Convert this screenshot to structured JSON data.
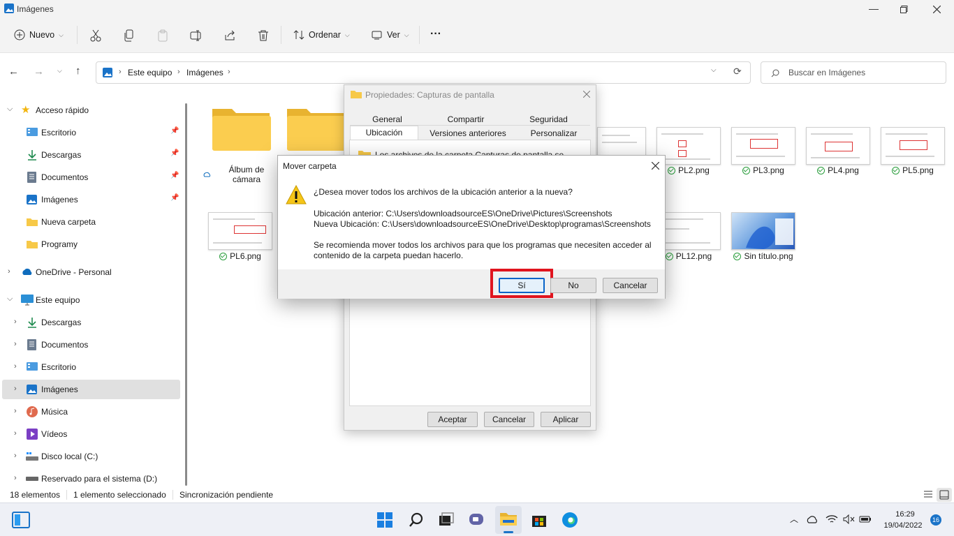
{
  "window": {
    "title": "Imágenes"
  },
  "toolbar": {
    "new_label": "Nuevo",
    "sort_label": "Ordenar",
    "view_label": "Ver",
    "more_label": "···"
  },
  "address": {
    "crumbs": [
      "Este equipo",
      "Imágenes"
    ],
    "search_placeholder": "Buscar en Imágenes"
  },
  "sidebar": {
    "quick_access": "Acceso rápido",
    "quick_items": [
      "Escritorio",
      "Descargas",
      "Documentos",
      "Imágenes",
      "Nueva carpeta",
      "Programy"
    ],
    "onedrive": "OneDrive - Personal",
    "this_pc": "Este equipo",
    "pc_items": [
      "Descargas",
      "Documentos",
      "Escritorio",
      "Imágenes",
      "Música",
      "Vídeos",
      "Disco local (C:)",
      "Reservado para el sistema (D:)"
    ]
  },
  "files": {
    "camera_folder": "Álbum de cámara",
    "row1": [
      "PL2.png",
      "PL3.png",
      "PL4.png",
      "PL5.png"
    ],
    "row2_first": "PL6.png",
    "row2_last": [
      "PL12.png",
      "Sin título.png"
    ]
  },
  "properties": {
    "title": "Propiedades: Capturas de pantalla",
    "tabs_top": [
      "General",
      "Compartir",
      "Seguridad"
    ],
    "tabs_bottom": [
      "Ubicación",
      "Versiones anteriores",
      "Personalizar"
    ],
    "partial_text": "Los archivos de la carpeta Capturas de pantalla se",
    "buttons": {
      "ok": "Aceptar",
      "cancel": "Cancelar",
      "apply": "Aplicar"
    }
  },
  "dialog": {
    "title": "Mover carpeta",
    "question": "¿Desea mover todos los archivos de la ubicación anterior a la nueva?",
    "old_location": "Ubicación anterior: C:\\Users\\downloadsourceES\\OneDrive\\Pictures\\Screenshots",
    "new_location": "Nueva Ubicación: C:\\Users\\downloadsourceES\\OneDrive\\Desktop\\programas\\Screenshots",
    "recommend_line1": "Se recomienda mover todos los archivos para que los programas que necesiten acceder al",
    "recommend_line2": "contenido de la carpeta puedan hacerlo.",
    "yes": "Sí",
    "no": "No",
    "cancel": "Cancelar",
    "highlight_color": "#e0141e"
  },
  "status": {
    "count": "18 elementos",
    "selected": "1 elemento seleccionado",
    "sync": "Sincronización pendiente"
  },
  "taskbar": {
    "time": "16:29",
    "date": "19/04/2022",
    "notifications": "16"
  }
}
